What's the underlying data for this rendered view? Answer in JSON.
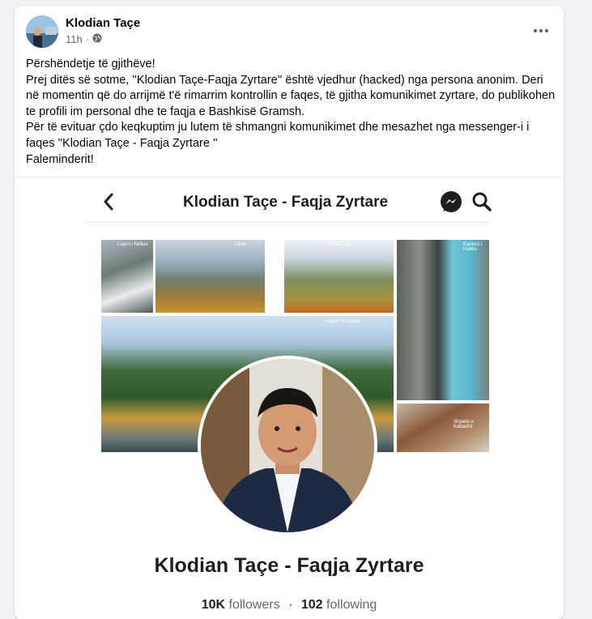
{
  "post": {
    "author": "Klodian Taçe",
    "time": "11h",
    "privacy_icon": "globe-icon",
    "more_icon": "more-dots-icon",
    "lines": [
      "Përshëndetje të gjithëve!",
      "Prej ditës së sotme, ''Klodian Taçe-Faqja Zyrtare'' është vjedhur (hacked) nga persona anonim. Deri në momentin që do arrijmë t'ë rimarrim kontrollin e faqes, të gjitha komunikimet zyrtare, do publikohen te profili im personal dhe te faqja e Bashkisë Gramsh.",
      "Për të evituar çdo keqkuptim ju lutem të shmangni komunikimet dhe mesazhet nga messenger-i i faqes ''Klodian Taçe - Faqja Zyrtare ''",
      "Faleminderit!"
    ]
  },
  "screenshot": {
    "nav_title": "Klodian Taçe - Faqja Zyrtare",
    "back_icon": "chevron-left-icon",
    "messenger_icon": "messenger-icon",
    "search_icon": "search-icon",
    "cover_labels": [
      "Liqeni i Noltas",
      "Lënie",
      "Liqeni i Zi",
      "Kanioni i Holtës",
      "Liqeni i Dushkut",
      "Shpella e Kabashit"
    ],
    "page_name": "Klodian Taçe - Faqja Zyrtare",
    "followers_count": "10K",
    "followers_label": "followers",
    "separator": "·",
    "following_count": "102",
    "following_label": "following"
  }
}
